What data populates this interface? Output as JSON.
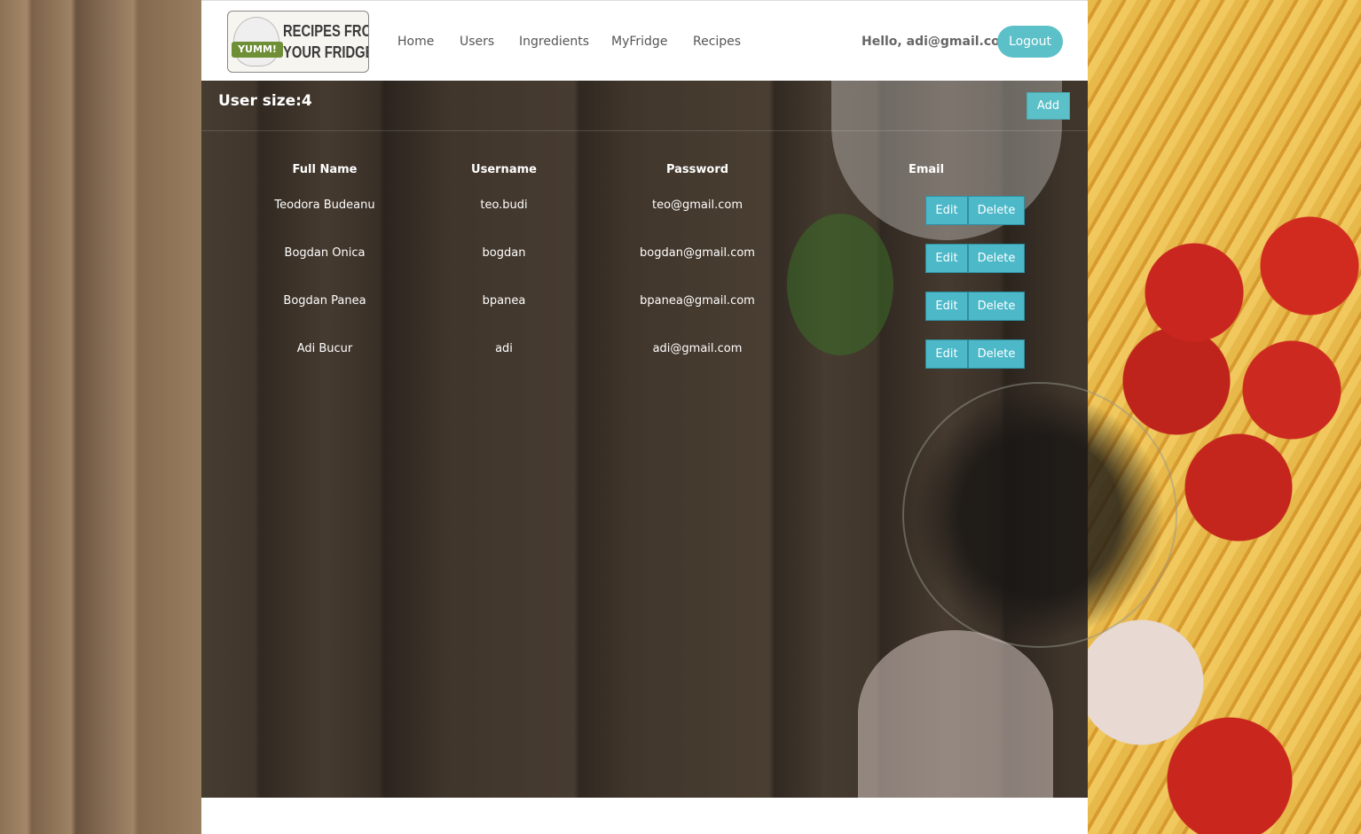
{
  "logo": {
    "badge": "YUMM!",
    "text_line1": "RECIPES FROM",
    "text_line2": "YOUR FRIDGE"
  },
  "nav": {
    "items": [
      {
        "label": "Home"
      },
      {
        "label": "Users"
      },
      {
        "label": "Ingredients"
      },
      {
        "label": "MyFridge"
      },
      {
        "label": "Recipes"
      }
    ],
    "greeting": "Hello, adi@gmail.com!",
    "logout_label": "Logout"
  },
  "panel": {
    "title": "User size:4",
    "add_label": "Add"
  },
  "table": {
    "headers": [
      "Full Name",
      "Username",
      "Password",
      "Email"
    ],
    "rows": [
      {
        "full_name": "Teodora Budeanu",
        "username": "teo.budi",
        "email": "teo@gmail.com",
        "edit": "Edit",
        "delete": "Delete"
      },
      {
        "full_name": "Bogdan Onica",
        "username": "bogdan",
        "email": "bogdan@gmail.com",
        "edit": "Edit",
        "delete": "Delete"
      },
      {
        "full_name": "Bogdan Panea",
        "username": "bpanea",
        "email": "bpanea@gmail.com",
        "edit": "Edit",
        "delete": "Delete"
      },
      {
        "full_name": "Adi Bucur",
        "username": "adi",
        "email": "adi@gmail.com",
        "edit": "Edit",
        "delete": "Delete"
      }
    ]
  },
  "colors": {
    "accent": "#5bc0c8",
    "row_button": "#4cb8c8"
  }
}
